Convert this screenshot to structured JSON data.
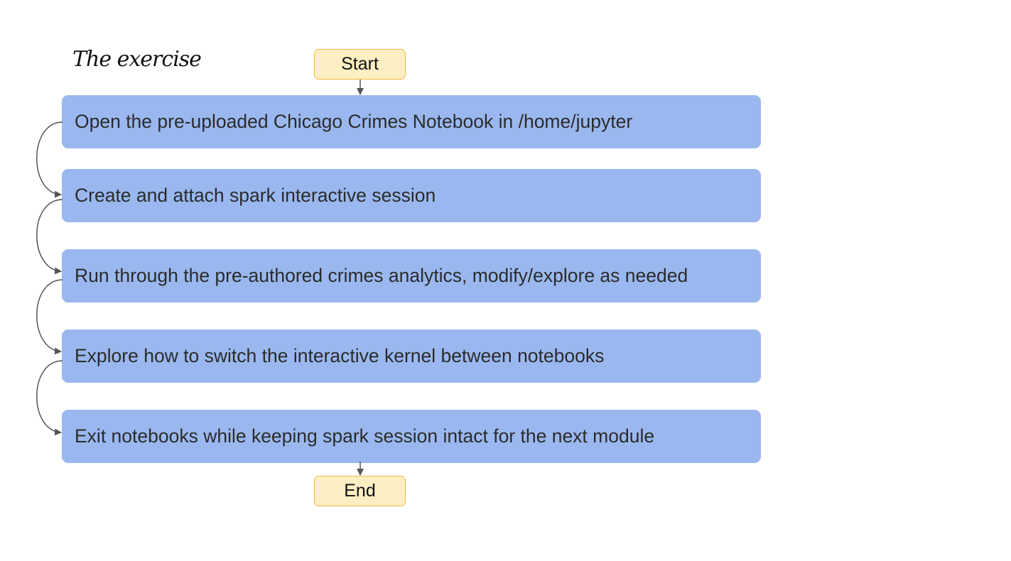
{
  "diagram": {
    "title": "The exercise",
    "start_label": "Start",
    "end_label": "End",
    "steps": [
      {
        "label": "Open the pre-uploaded Chicago Crimes Notebook in /home/jupyter"
      },
      {
        "label": "Create and attach spark interactive session"
      },
      {
        "label": "Run through the pre-authored crimes analytics, modify/explore as needed"
      },
      {
        "label": "Explore how to switch the interactive kernel between notebooks"
      },
      {
        "label": "Exit notebooks while keeping spark session intact for the next module"
      }
    ],
    "colors": {
      "step_fill": "#9ab8ef",
      "terminal_fill": "#fdefc3",
      "terminal_border": "#f3b73f",
      "connector": "#555555"
    }
  }
}
